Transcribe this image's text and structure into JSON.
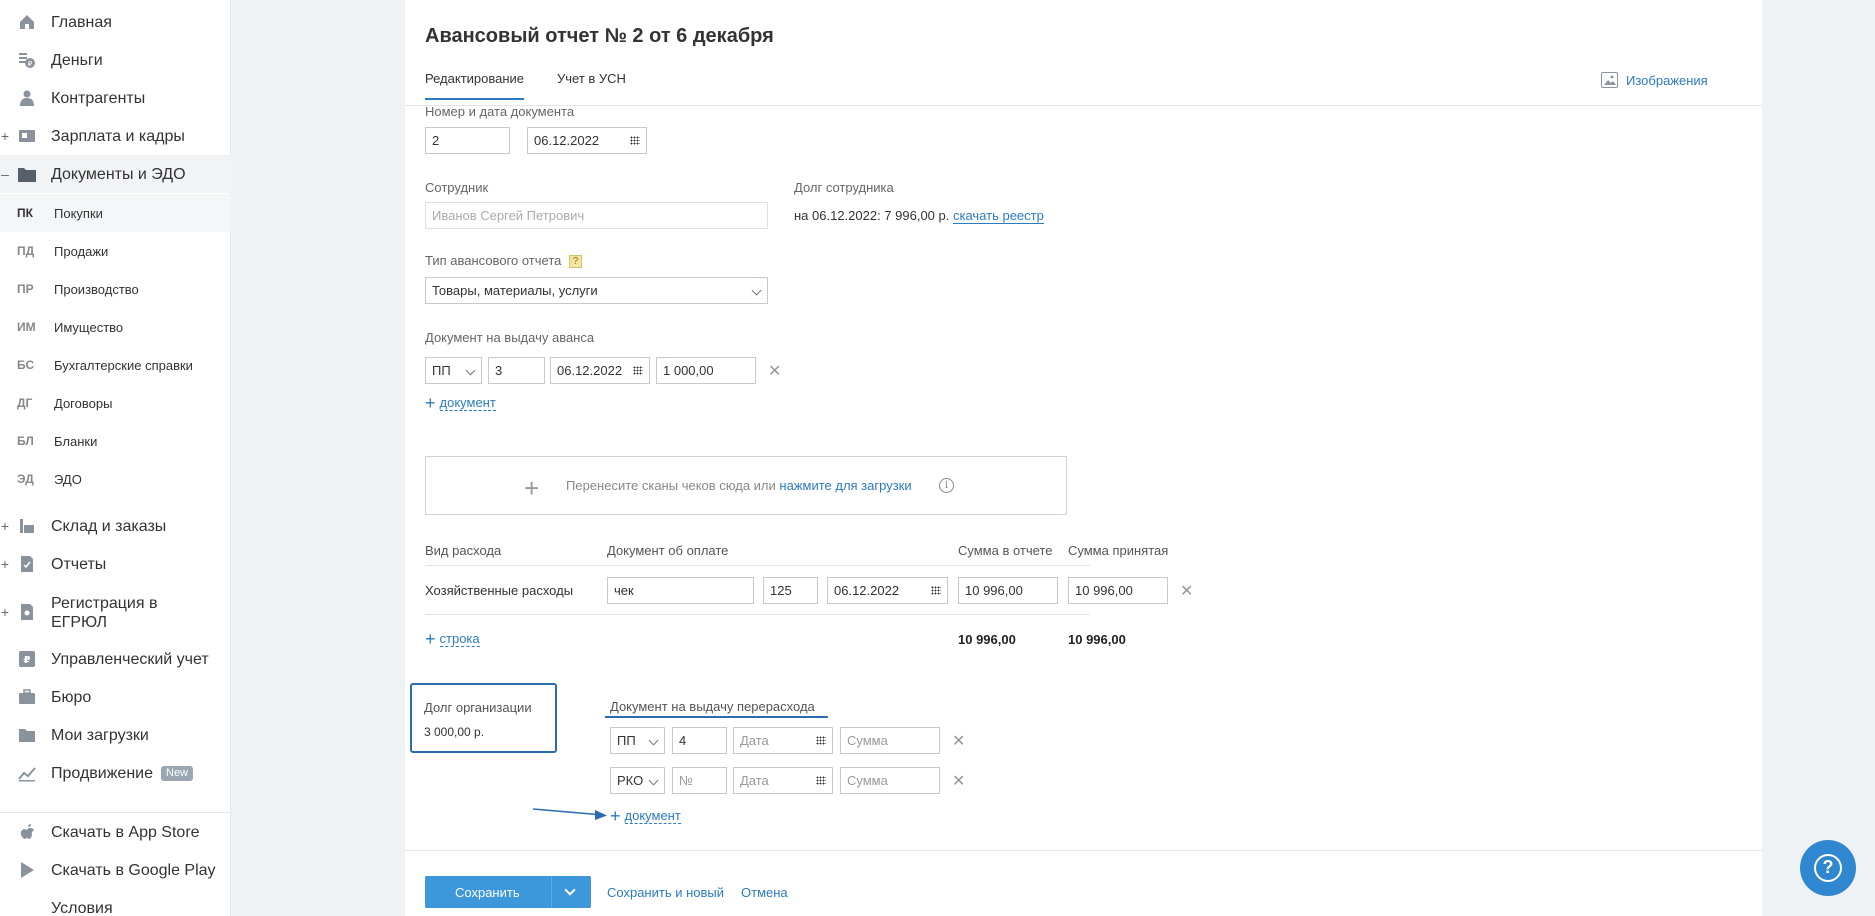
{
  "sidebar": {
    "main": [
      {
        "label": "Главная",
        "icon": "home-icon"
      },
      {
        "label": "Деньги",
        "icon": "money-icon"
      },
      {
        "label": "Контрагенты",
        "icon": "contractors-icon"
      },
      {
        "label": "Зарплата и кадры",
        "icon": "salary-icon",
        "expander": "+"
      },
      {
        "label": "Документы и ЭДО",
        "icon": "folder-icon",
        "expander": "–"
      }
    ],
    "sub": [
      {
        "abbr": "ПК",
        "label": "Покупки"
      },
      {
        "abbr": "ПД",
        "label": "Продажи"
      },
      {
        "abbr": "ПР",
        "label": "Производство"
      },
      {
        "abbr": "ИМ",
        "label": "Имущество"
      },
      {
        "abbr": "БС",
        "label": "Бухгалтерские справки"
      },
      {
        "abbr": "ДГ",
        "label": "Договоры"
      },
      {
        "abbr": "БЛ",
        "label": "Бланки"
      },
      {
        "abbr": "ЭД",
        "label": "ЭДО"
      }
    ],
    "more": [
      {
        "label": "Склад и заказы",
        "icon": "warehouse-icon",
        "expander": "+"
      },
      {
        "label": "Отчеты",
        "icon": "reports-icon",
        "expander": "+"
      },
      {
        "label": "Регистрация в",
        "label2": "ЕГРЮЛ",
        "icon": "registration-icon",
        "expander": "+"
      },
      {
        "label": "Управленческий учет",
        "icon": "management-icon"
      },
      {
        "label": "Бюро",
        "icon": "briefcase-icon"
      },
      {
        "label": "Мои загрузки",
        "icon": "downloads-folder-icon"
      },
      {
        "label": "Продвижение",
        "icon": "promotion-icon",
        "badge": "New"
      }
    ],
    "bottom": [
      {
        "label": "Скачать в App Store",
        "icon": "apple-icon"
      },
      {
        "label": "Скачать в Google Play",
        "icon": "google-play-icon"
      },
      {
        "label": "Условия",
        "icon": ""
      }
    ]
  },
  "doc": {
    "title": "Авансовый отчет № 2 от 6 декабря",
    "tabs": [
      "Редактирование",
      "Учет в УСН"
    ],
    "images_link": "Изображения",
    "num_date_label": "Номер и дата документа",
    "number": "2",
    "date": "06.12.2022",
    "employee_label": "Сотрудник",
    "employee_value": "Иванов Сергей Петрович",
    "employee_debt_label": "Долг сотрудника",
    "employee_debt_text": "на 06.12.2022: 7 996,00 р.",
    "download_registry": "скачать реестр",
    "report_type_label": "Тип авансового отчета",
    "report_type_help": "?",
    "report_type_value": "Товары, материалы, услуги",
    "advance_doc_label": "Документ на выдачу аванса",
    "advance_doc": {
      "type": "ПП",
      "number": "3",
      "date": "06.12.2022",
      "amount": "1 000,00"
    },
    "add_document": "документ",
    "upload_text": "Перенесите сканы чеков сюда или",
    "upload_link": "нажмите для загрузки",
    "upload_info": "i",
    "table_headers": [
      "Вид расхода",
      "Документ об оплате",
      "Сумма в отчете",
      "Сумма принятая"
    ],
    "row": {
      "kind": "Хозяйственные расходы",
      "doc": "чек",
      "number": "125",
      "date": "06.12.2022",
      "sum_report": "10 996,00",
      "sum_accepted": "10 996,00"
    },
    "add_row": "строка",
    "total_report": "10 996,00",
    "total_accepted": "10 996,00",
    "org_debt_label": "Долг организации",
    "org_debt_value": "3 000,00 р.",
    "overspend_doc_label": "Документ на выдачу перерасхода",
    "overspend_rows": [
      {
        "type": "ПП",
        "number": "4",
        "date_ph": "Дата",
        "sum_ph": "Сумма"
      },
      {
        "type": "РКО",
        "number_ph": "№",
        "date_ph": "Дата",
        "sum_ph": "Сумма"
      }
    ],
    "overspend_add": "документ",
    "x_glyph": "✕",
    "plus_glyph": "+"
  },
  "footer": {
    "save": "Сохранить",
    "save_and_new": "Сохранить и новый",
    "cancel": "Отмена"
  },
  "help_glyph": "?",
  "colors": {
    "accent": "#2b7bc0",
    "button": "#3d97db",
    "highlight_box": "#2b6cb0"
  }
}
